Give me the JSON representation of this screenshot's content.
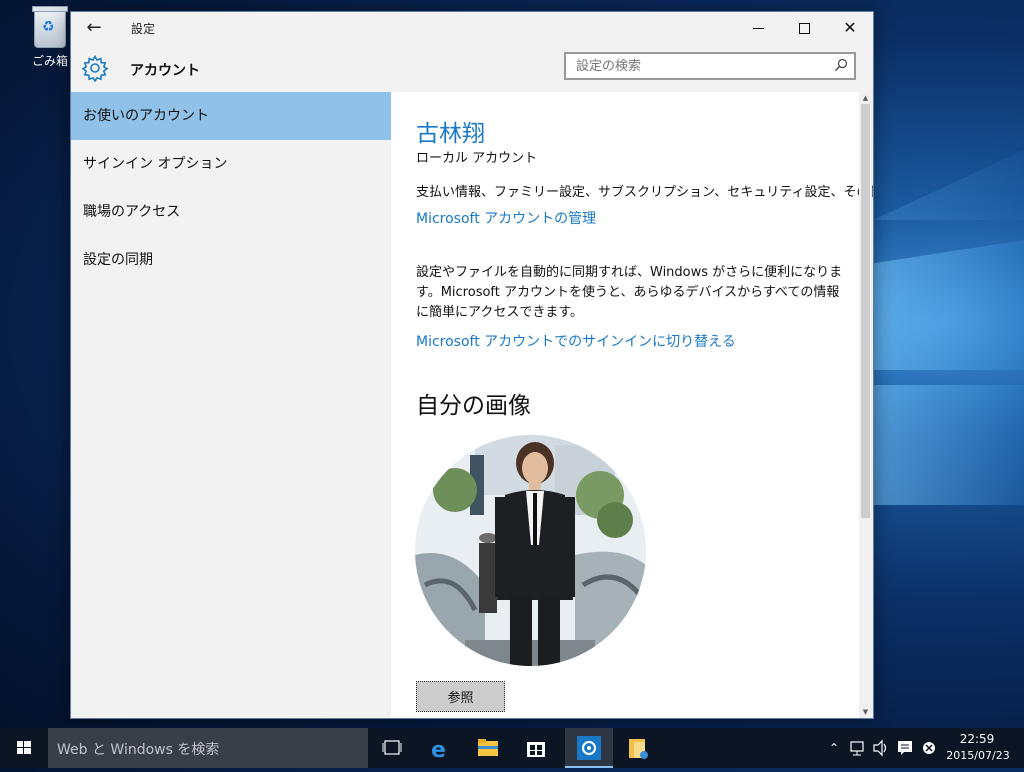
{
  "desktop": {
    "recycle_bin_label": "ごみ箱"
  },
  "window": {
    "title": "設定",
    "header_title": "アカウント",
    "search_placeholder": "設定の検索"
  },
  "sidebar": {
    "items": [
      {
        "label": "お使いのアカウント",
        "active": true
      },
      {
        "label": "サインイン オプション",
        "active": false
      },
      {
        "label": "職場のアクセス",
        "active": false
      },
      {
        "label": "設定の同期",
        "active": false
      }
    ]
  },
  "content": {
    "user_name": "古林翔",
    "account_type": "ローカル アカウント",
    "billing_text": "支払い情報、ファミリー設定、サブスクリプション、セキュリティ設定、その他",
    "manage_link": "Microsoft アカウントの管理",
    "sync_text": "設定やファイルを自動的に同期すれば、Windows がさらに便利になります。Microsoft アカウントを使うと、あらゆるデバイスからすべての情報に簡単にアクセスできます。",
    "switch_link": "Microsoft アカウントでのサインインに切り替える",
    "picture_title": "自分の画像",
    "browse_button": "参照"
  },
  "taskbar": {
    "search_text": "Web と Windows を検索",
    "time": "22:59",
    "date": "2015/07/23"
  },
  "colors": {
    "accent": "#1a79c7",
    "sidebar_active": "#90c1e8"
  }
}
